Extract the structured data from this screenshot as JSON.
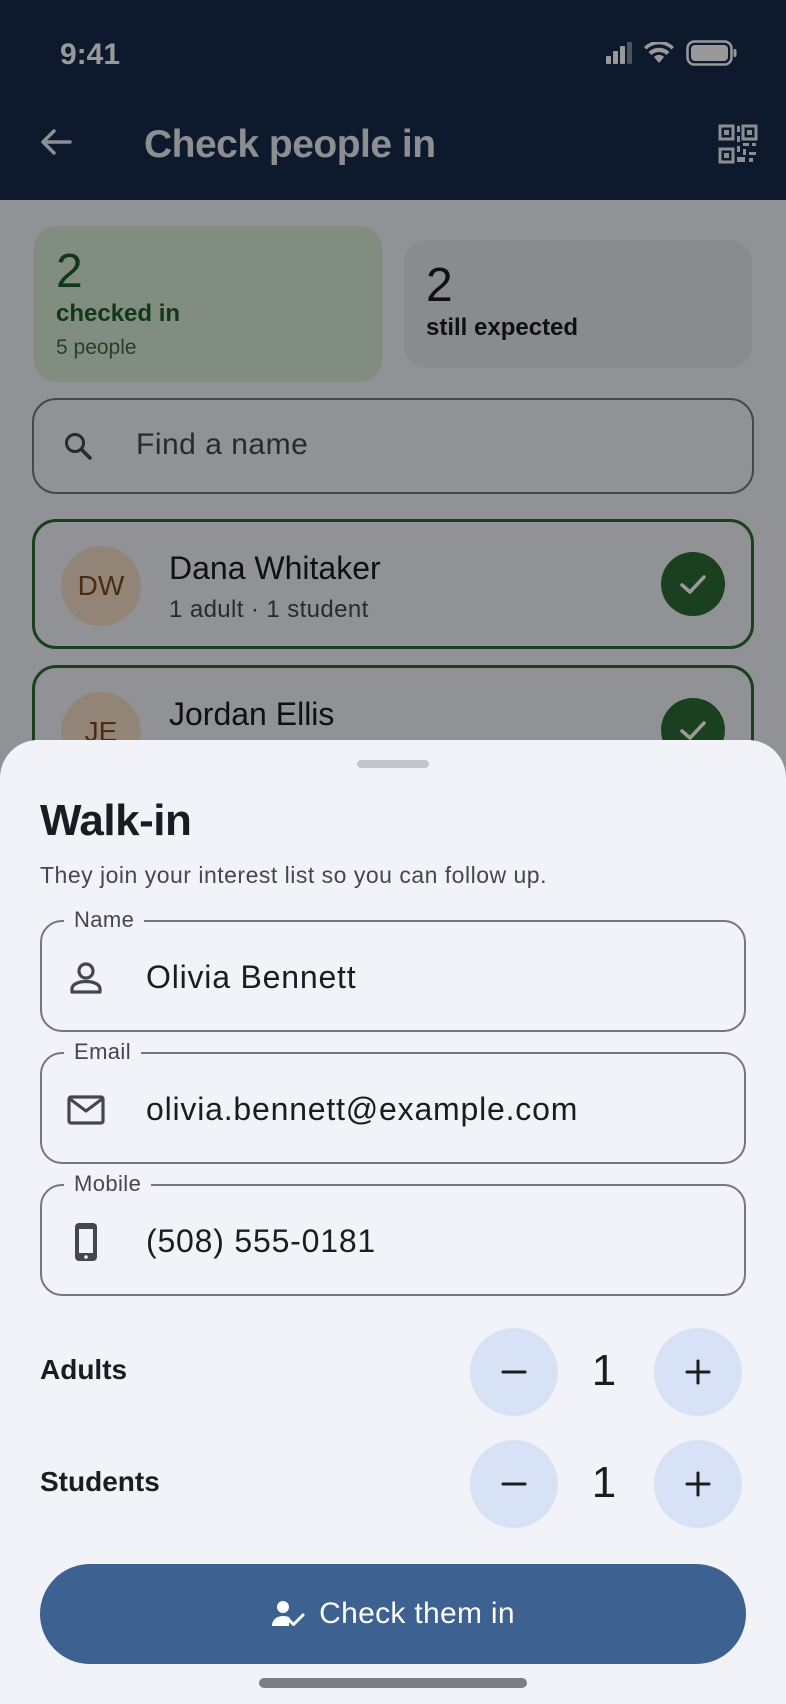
{
  "status_bar": {
    "time": "9:41"
  },
  "app_bar": {
    "title": "Check people in"
  },
  "stats": {
    "checked_in": {
      "count": "2",
      "label": "checked in",
      "sub": "5 people"
    },
    "expected": {
      "count": "2",
      "label": "still expected"
    }
  },
  "search": {
    "placeholder": "Find a name"
  },
  "people": [
    {
      "initials": "DW",
      "name": "Dana Whitaker",
      "detail": "1 adult · 1 student"
    },
    {
      "initials": "JE",
      "name": "Jordan Ellis"
    }
  ],
  "sheet": {
    "title": "Walk-in",
    "subtitle": "They join your interest list so you can follow up.",
    "fields": {
      "name": {
        "label": "Name",
        "value": "Olivia Bennett"
      },
      "email": {
        "label": "Email",
        "value": "olivia.bennett@example.com"
      },
      "mobile": {
        "label": "Mobile",
        "value": "(508) 555-0181"
      }
    },
    "counters": {
      "adults": {
        "label": "Adults",
        "value": "1"
      },
      "students": {
        "label": "Students",
        "value": "1"
      }
    },
    "submit_label": "Check them in"
  },
  "colors": {
    "app_bar": "#162b4c",
    "accent_green": "#2e6b35",
    "primary_button": "#3d6190",
    "stepper_button": "#d8e2f6"
  }
}
